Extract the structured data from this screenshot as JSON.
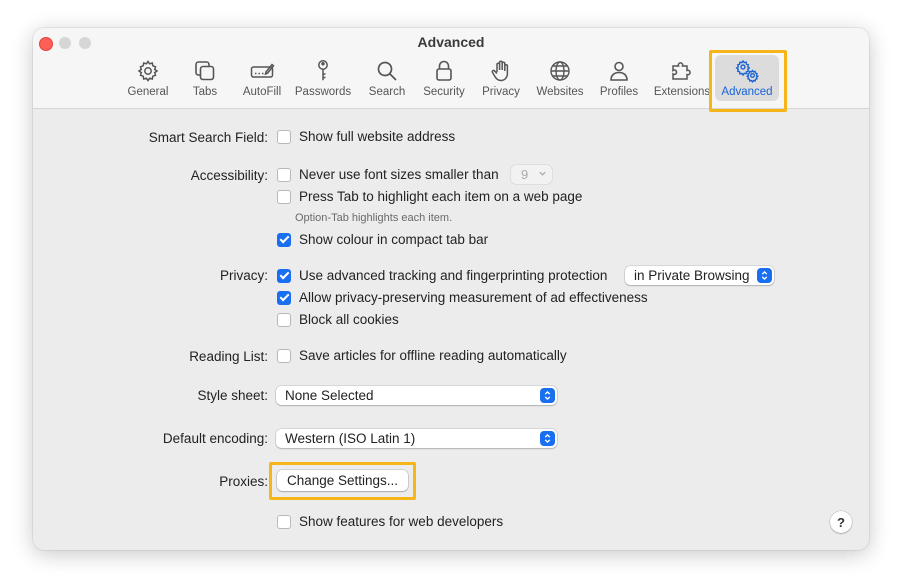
{
  "window": {
    "title": "Advanced"
  },
  "toolbar": {
    "tabs": [
      {
        "label": "General",
        "icon": "gear-icon"
      },
      {
        "label": "Tabs",
        "icon": "tabs-icon"
      },
      {
        "label": "AutoFill",
        "icon": "autofill-icon"
      },
      {
        "label": "Passwords",
        "icon": "key-icon"
      },
      {
        "label": "Search",
        "icon": "magnifier-icon"
      },
      {
        "label": "Security",
        "icon": "lock-icon"
      },
      {
        "label": "Privacy",
        "icon": "hand-icon"
      },
      {
        "label": "Websites",
        "icon": "globe-icon"
      },
      {
        "label": "Profiles",
        "icon": "person-icon"
      },
      {
        "label": "Extensions",
        "icon": "puzzle-icon"
      },
      {
        "label": "Advanced",
        "icon": "gears-icon"
      }
    ],
    "active_tab": "Advanced"
  },
  "settings": {
    "smart_search": {
      "label": "Smart Search Field:",
      "option": "Show full website address",
      "checked": false
    },
    "accessibility": {
      "label": "Accessibility:",
      "min_font": {
        "text": "Never use font sizes smaller than",
        "checked": false,
        "value": "9"
      },
      "press_tab": {
        "text": "Press Tab to highlight each item on a web page",
        "checked": false
      },
      "note": "Option-Tab highlights each item.",
      "show_colour": {
        "text": "Show colour in compact tab bar",
        "checked": true
      }
    },
    "privacy": {
      "label": "Privacy:",
      "tracking": {
        "text": "Use advanced tracking and fingerprinting protection",
        "checked": true,
        "value": "in Private Browsing"
      },
      "measurement": {
        "text": "Allow privacy-preserving measurement of ad effectiveness",
        "checked": true
      },
      "block_cookies": {
        "text": "Block all cookies",
        "checked": false
      }
    },
    "reading_list": {
      "label": "Reading List:",
      "option": "Save articles for offline reading automatically",
      "checked": false
    },
    "style_sheet": {
      "label": "Style sheet:",
      "value": "None Selected"
    },
    "default_encoding": {
      "label": "Default encoding:",
      "value": "Western (ISO Latin 1)"
    },
    "proxies": {
      "label": "Proxies:",
      "button": "Change Settings..."
    },
    "developer": {
      "text": "Show features for web developers",
      "checked": false
    }
  },
  "help": {
    "label": "?"
  },
  "colors": {
    "accent": "#1a6ff0",
    "highlight": "#f6b519",
    "active_tab_text": "#1a63d6"
  }
}
